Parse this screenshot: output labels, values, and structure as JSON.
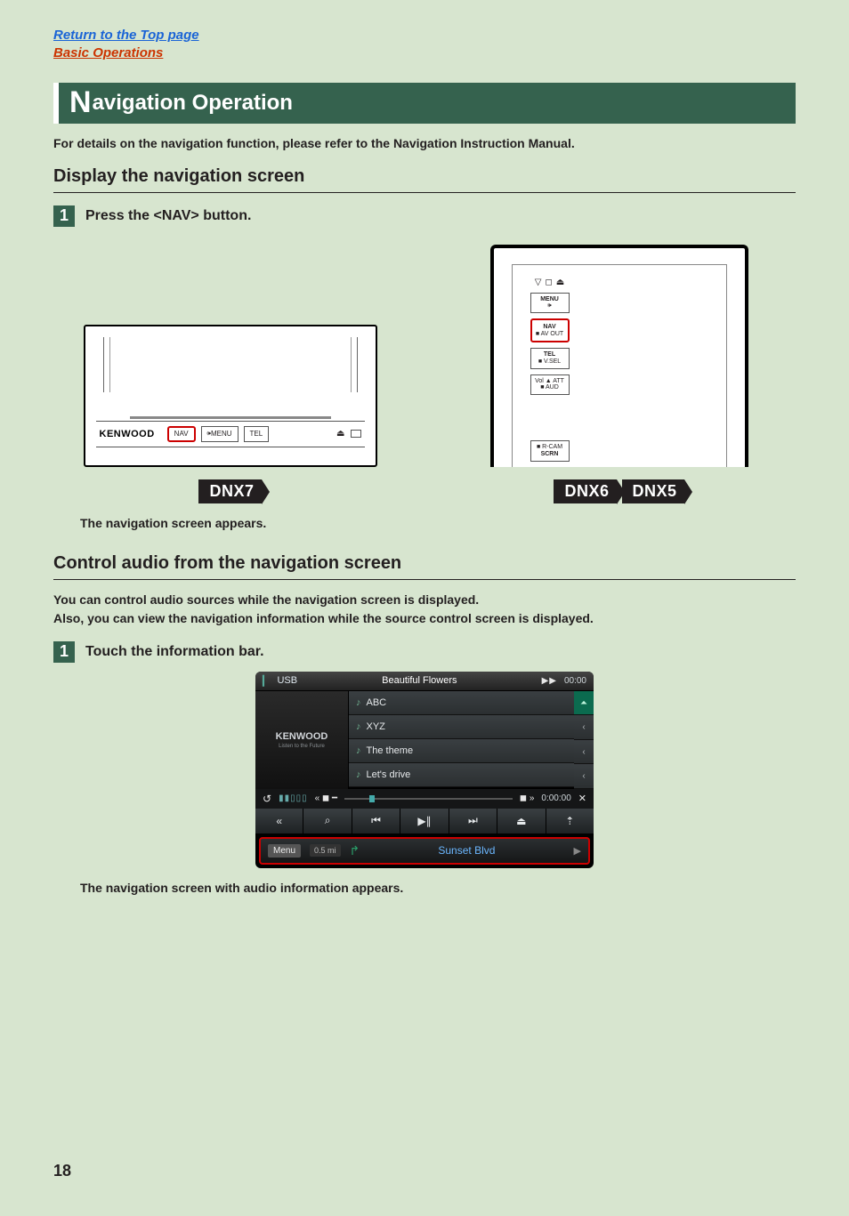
{
  "links": {
    "top": "Return to the Top page",
    "section": "Basic Operations"
  },
  "banner": {
    "initial": "N",
    "rest": "avigation Operation"
  },
  "intro": "For details on the navigation function, please refer to the Navigation Instruction Manual.",
  "h_display": "Display the navigation screen",
  "step1": {
    "num": "1",
    "label": "Press the <NAV> button."
  },
  "device7": {
    "brand": "KENWOOD",
    "nav": "NAV",
    "menu": "MENU",
    "tel": "TEL",
    "eject": "⏏"
  },
  "badges": {
    "dnx7": "DNX7",
    "dnx6": "DNX6",
    "dnx5": "DNX5"
  },
  "device65": {
    "icons": {
      "down": "▽",
      "stop": "◻",
      "eject": "⏏"
    },
    "menu": "MENU",
    "nav_line1": "NAV",
    "nav_line2": "■ AV OUT",
    "tel_line1": "TEL",
    "tel_line2": "■ V.SEL",
    "att_line1": "Vol ▲ ATT",
    "att_line2": "■ AUD",
    "scrn_line1": "■ R-CAM",
    "scrn_line2": "SCRN"
  },
  "caption1": "The navigation screen appears.",
  "h_audio": "Control audio from the navigation screen",
  "audio_intro1": "You can control audio sources while the navigation screen is displayed.",
  "audio_intro2": "Also, you can view the navigation information while the source control screen is displayed.",
  "step2": {
    "num": "1",
    "label": "Touch the information bar."
  },
  "af": {
    "src": "USB",
    "title": "Beautiful Flowers",
    "ff": "▶▶",
    "top_time": "00:00",
    "brand": "KENWOOD",
    "tag": "Listen to the Future",
    "tracks": [
      "ABC",
      "XYZ",
      "The theme",
      "Let's drive"
    ],
    "loop": "↺",
    "bars": "▮▮▯▯▯",
    "seek_mini": "« ◼ ━",
    "seek_icons": "◼ »",
    "seek_time": "0:00:00",
    "shuffle": "✕",
    "ctrl": {
      "back": "«",
      "search": "⌕",
      "prev": "⏮",
      "play": "▶∥",
      "next": "⏭",
      "eject": "⏏",
      "up": "⇡"
    },
    "nav": {
      "menu": "Menu",
      "dist": "0.5 mi",
      "arrow": "↱",
      "street": "Sunset Blvd",
      "tri": "▶"
    }
  },
  "caption2": "The navigation screen with audio information appears.",
  "page": "18"
}
